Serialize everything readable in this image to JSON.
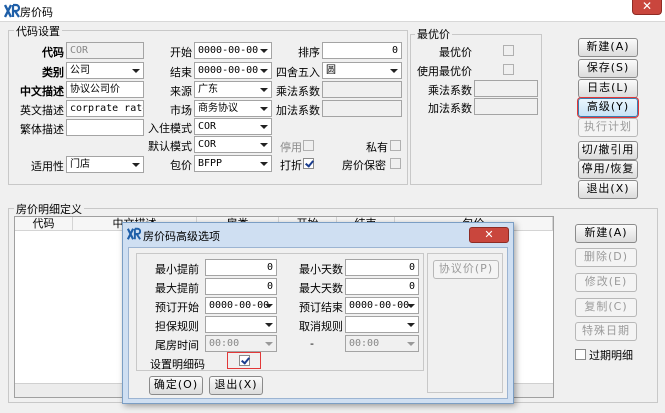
{
  "window": {
    "title": "房价码",
    "close_glyph": "✕"
  },
  "code_settings": {
    "group_label": "代码设置",
    "code_label": "代码",
    "code_value": "COR",
    "category_label": "类别",
    "category_value": "公司",
    "cn_desc_label": "中文描述",
    "cn_desc_value": "协议公司价",
    "en_desc_label": "英文描述",
    "en_desc_value": "corprate rate",
    "trad_desc_label": "繁体描述",
    "trad_desc_value": "",
    "applicable_label": "适用性",
    "applicable_value": "门店",
    "start_label": "开始",
    "start_value": "0000-00-00",
    "end_label": "结束",
    "end_value": "0000-00-00",
    "source_label": "来源",
    "source_value": "广东",
    "market_label": "市场",
    "market_value": "商务协议",
    "checkin_mode_label": "入住模式",
    "checkin_mode_value": "COR",
    "default_mode_label": "默认模式",
    "default_mode_value": "COR",
    "package_label": "包价",
    "package_value": "BFPP",
    "sort_label": "排序",
    "sort_value": "0",
    "round_label": "四舍五入",
    "round_value": "圆",
    "multiply_label": "乘法系数",
    "multiply_value": "",
    "add_label": "加法系数",
    "add_value": "",
    "disable_label": "停用",
    "disable_checked": false,
    "private_label": "私有",
    "private_checked": false,
    "discount_label": "打折",
    "discount_checked": true,
    "confidential_label": "房价保密",
    "confidential_checked": false
  },
  "best_price": {
    "group_label": "最优价",
    "best_label": "最优价",
    "best_checked": false,
    "use_best_label": "使用最优价",
    "use_best_checked": false,
    "multiply_label": "乘法系数",
    "multiply_value": "",
    "add_label": "加法系数",
    "add_value": ""
  },
  "right_buttons": {
    "new": "新建(A)",
    "save": "保存(S)",
    "log": "日志(L)",
    "advanced": "高级(Y)",
    "exec_plan": "执行计划",
    "switch_undo": "切/撤引用",
    "disable_restore": "停用/恢复",
    "exit": "退出(X)"
  },
  "detail": {
    "group_label": "房价明细定义",
    "columns": [
      "代码",
      "中文描述",
      "房类",
      "开始",
      "结束",
      "包价"
    ],
    "buttons": {
      "new": "新建(A)",
      "delete": "删除(D)",
      "modify": "修改(E)",
      "copy": "复制(C)",
      "special_date": "特殊日期"
    },
    "expired_label": "过期明细",
    "expired_checked": false
  },
  "dialog": {
    "title": "房价码高级选项",
    "close_glyph": "✕",
    "min_advance_label": "最小提前",
    "min_advance_value": "0",
    "max_advance_label": "最大提前",
    "max_advance_value": "0",
    "min_days_label": "最小天数",
    "min_days_value": "0",
    "max_days_label": "最大天数",
    "max_days_value": "0",
    "book_start_label": "预订开始",
    "book_start_value": "0000-00-00",
    "book_end_label": "预订结束",
    "book_end_value": "0000-00-00",
    "guarantee_label": "担保规则",
    "guarantee_value": "",
    "cancel_label": "取消规则",
    "cancel_value": "",
    "tail_time_label": "尾房时间",
    "tail_time_start": "00:00",
    "tail_time_sep": "-",
    "tail_time_end": "00:00",
    "detail_code_label": "设置明细码",
    "detail_code_checked": true,
    "agreement_price_button": "协议价(P)",
    "ok_button": "确定(O)",
    "exit_button": "退出(X)"
  },
  "colors": {
    "close_red": "#c9463d",
    "dialog_frame": "#cfdff2",
    "focus_blue": "#3c7fb1",
    "highlight_red": "#e23838"
  }
}
